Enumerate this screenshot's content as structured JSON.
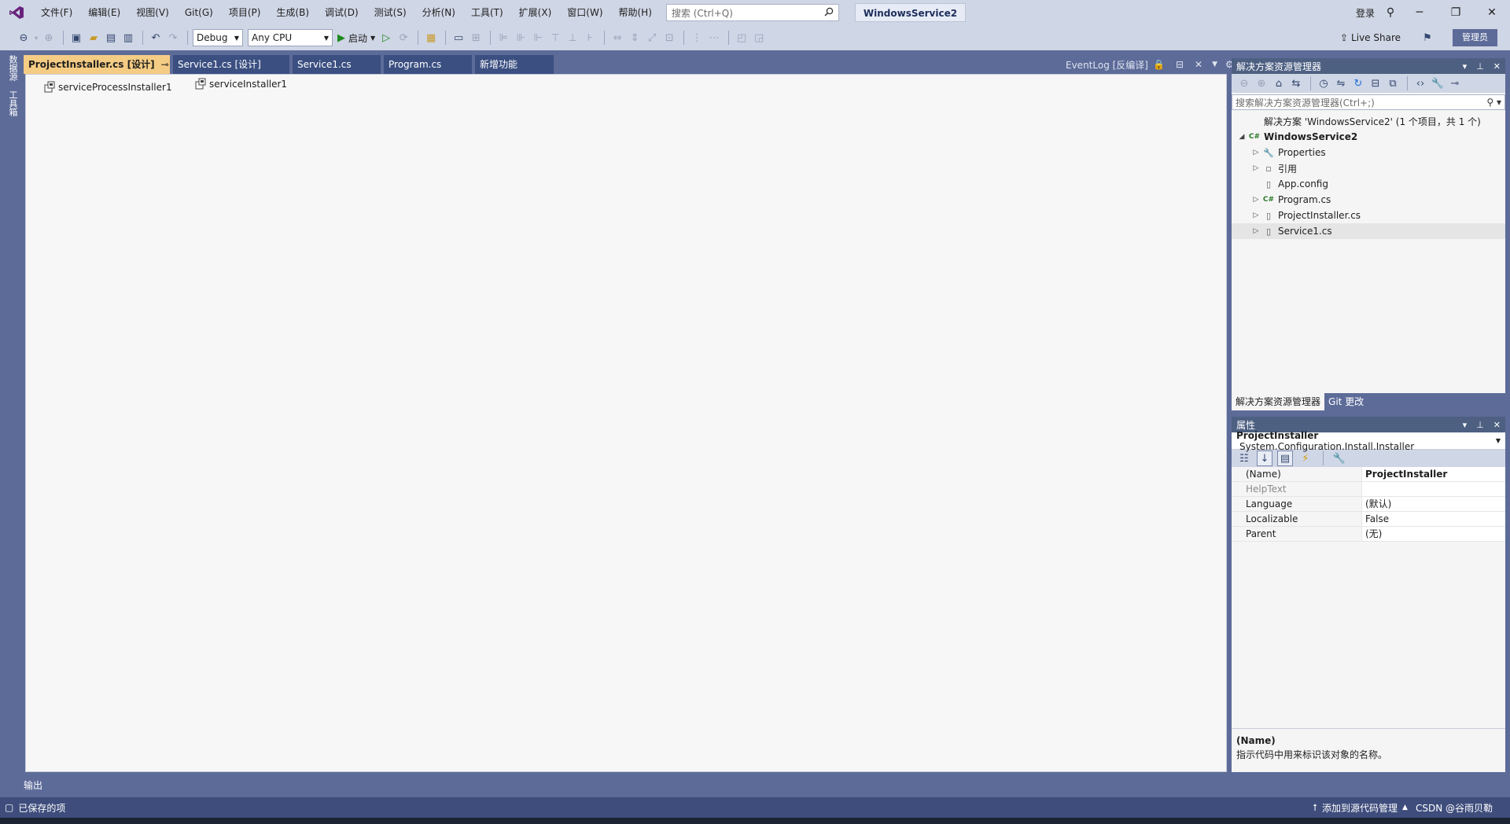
{
  "menu": [
    "文件(F)",
    "编辑(E)",
    "视图(V)",
    "Git(G)",
    "项目(P)",
    "生成(B)",
    "调试(D)",
    "测试(S)",
    "分析(N)",
    "工具(T)",
    "扩展(X)",
    "窗口(W)",
    "帮助(H)"
  ],
  "search": {
    "placeholder": "搜索 (Ctrl+Q)"
  },
  "solution_name": "WindowsService2",
  "title_right": {
    "login": "登录"
  },
  "toolbar": {
    "config": "Debug",
    "platform": "Any CPU",
    "start": "启动",
    "live_share": "Live Share",
    "admin": "管理员"
  },
  "left_strip": [
    "数据源",
    "工具箱"
  ],
  "doc_tabs": [
    {
      "label": "ProjectInstaller.cs [设计]",
      "active": true
    },
    {
      "label": "Service1.cs [设计]",
      "active": false
    },
    {
      "label": "Service1.cs",
      "active": false
    },
    {
      "label": "Program.cs",
      "active": false
    },
    {
      "label": "新增功能",
      "active": false
    }
  ],
  "doc_tabs_right": "EventLog [反编译]",
  "design_components": [
    "serviceProcessInstaller1",
    "serviceInstaller1"
  ],
  "solution_explorer": {
    "title": "解决方案资源管理器",
    "search_placeholder": "搜索解决方案资源管理器(Ctrl+;)",
    "tree": [
      {
        "label": "解决方案 'WindowsService2' (1 个项目，共 1 个)",
        "level": 0,
        "icon": "solution-icon",
        "glyph": "",
        "expand": ""
      },
      {
        "label": "WindowsService2",
        "level": 0,
        "icon": "csproj-icon",
        "glyph": "C#",
        "expand": "◢",
        "bold": true
      },
      {
        "label": "Properties",
        "level": 1,
        "icon": "wrench-icon",
        "glyph": "🔧",
        "expand": "▷"
      },
      {
        "label": "引用",
        "level": 1,
        "icon": "references-icon",
        "glyph": "▫",
        "expand": "▷"
      },
      {
        "label": "App.config",
        "level": 1,
        "icon": "config-file-icon",
        "glyph": "▯",
        "expand": ""
      },
      {
        "label": "Program.cs",
        "level": 1,
        "icon": "csharp-file-icon",
        "glyph": "C#",
        "expand": "▷"
      },
      {
        "label": "ProjectInstaller.cs",
        "level": 1,
        "icon": "component-file-icon",
        "glyph": "▯",
        "expand": "▷"
      },
      {
        "label": "Service1.cs",
        "level": 1,
        "icon": "component-file-icon",
        "glyph": "▯",
        "expand": "▷",
        "selected": true
      }
    ]
  },
  "bottom_tabs": [
    "解决方案资源管理器",
    "Git 更改"
  ],
  "properties": {
    "title": "属性",
    "object_name": "ProjectInstaller",
    "object_type": "System.Configuration.Install.Installer",
    "rows": [
      {
        "name": "(Name)",
        "value": "ProjectInstaller",
        "bold": true
      },
      {
        "name": "HelpText",
        "value": "",
        "dim": true
      },
      {
        "name": "Language",
        "value": "(默认)"
      },
      {
        "name": "Localizable",
        "value": "False"
      },
      {
        "name": "Parent",
        "value": "(无)"
      }
    ],
    "desc_title": "(Name)",
    "desc_text": "指示代码中用来标识该对象的名称。"
  },
  "output_label": "输出",
  "status": {
    "left": "已保存的项",
    "source_control": "添加到源代码管理",
    "repo": "CSDN @谷雨贝勒"
  },
  "colors": {
    "accent": "#5d6b99",
    "active_tab": "#f5cc84",
    "chrome": "#cfd6e5"
  }
}
